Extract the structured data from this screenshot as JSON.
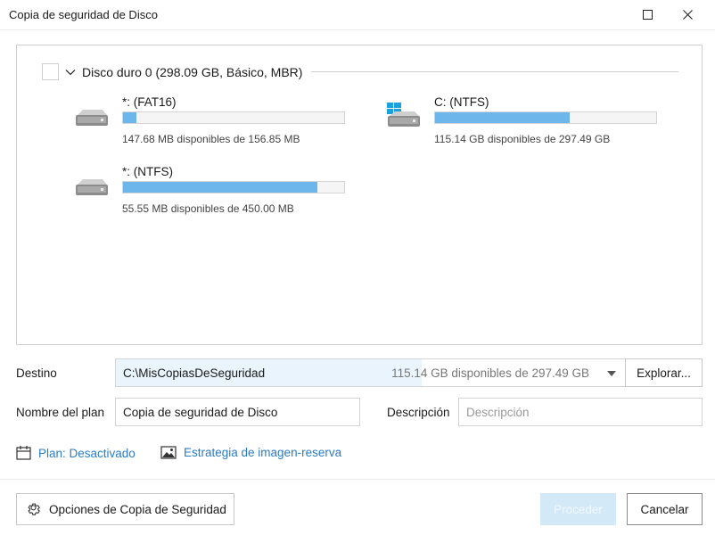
{
  "window": {
    "title": "Copia de seguridad de Disco"
  },
  "disk": {
    "title": "Disco duro 0 (298.09 GB, Básico, MBR)",
    "partitions": [
      {
        "name": "*: (FAT16)",
        "info": "147.68 MB disponibles de 156.85 MB",
        "used_fraction": 0.06,
        "icon": "drive-icon"
      },
      {
        "name": "C: (NTFS)",
        "info": "115.14 GB disponibles de 297.49 GB",
        "used_fraction": 0.61,
        "icon": "windows-drive-icon"
      },
      {
        "name": "*: (NTFS)",
        "info": "55.55 MB disponibles de 450.00 MB",
        "used_fraction": 0.88,
        "icon": "drive-icon"
      }
    ]
  },
  "form": {
    "destination_label": "Destino",
    "destination_path": "C:\\MisCopiasDeSeguridad",
    "destination_space": "115.14 GB disponibles de 297.49 GB",
    "browse_label": "Explorar...",
    "plan_name_label": "Nombre del plan",
    "plan_name_value": "Copia de seguridad de Disco",
    "description_label": "Descripción",
    "description_placeholder": "Descripción"
  },
  "links": {
    "schedule": "Plan: Desactivado",
    "image_strategy": "Estrategia de imagen-reserva"
  },
  "footer": {
    "options_label": "Opciones de Copia de Seguridad",
    "proceed_label": "Proceder",
    "cancel_label": "Cancelar"
  },
  "colors": {
    "accent": "#2b7cc4",
    "usage_bar": "#6cb6ec",
    "windows_logo": "#1aa1e0"
  }
}
